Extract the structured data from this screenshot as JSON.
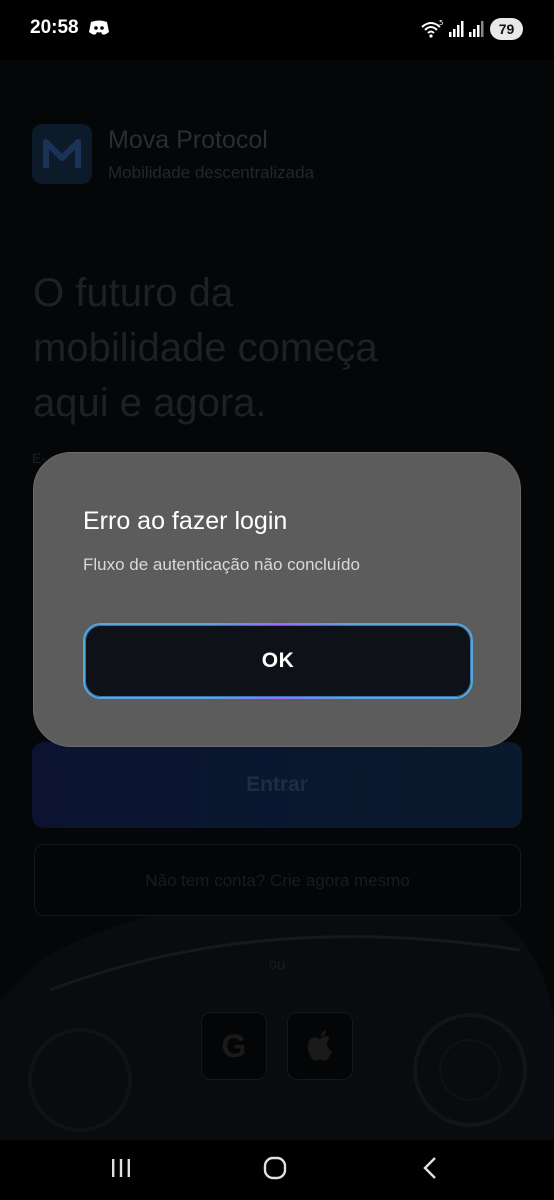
{
  "status_bar": {
    "time": "20:58",
    "battery": "79",
    "icons": [
      "discord-icon",
      "wifi-icon",
      "signal-icon",
      "signal-icon"
    ]
  },
  "app": {
    "name": "Mova Protocol",
    "tagline": "Mobilidade descentralizada",
    "hero_line1": "O futuro da",
    "hero_line2": "mobilidade começa",
    "hero_line3": "aqui e agora.",
    "email_label_partial": "E-",
    "login_label": "Entrar",
    "signup_label": "Não tem conta? Crie agora mesmo",
    "or_label": "ou",
    "social": [
      "google-icon",
      "apple-icon"
    ]
  },
  "dialog": {
    "title": "Erro ao fazer login",
    "message": "Fluxo de autenticação não concluído",
    "ok_label": "OK"
  },
  "nav": {
    "icons": [
      "recent-apps-icon",
      "home-icon",
      "back-icon"
    ]
  },
  "colors": {
    "dialog_bg": "#5c5c5c",
    "ok_border": "#56a7e0",
    "ok_bg": "#0e1117",
    "overlay": "#000000"
  }
}
